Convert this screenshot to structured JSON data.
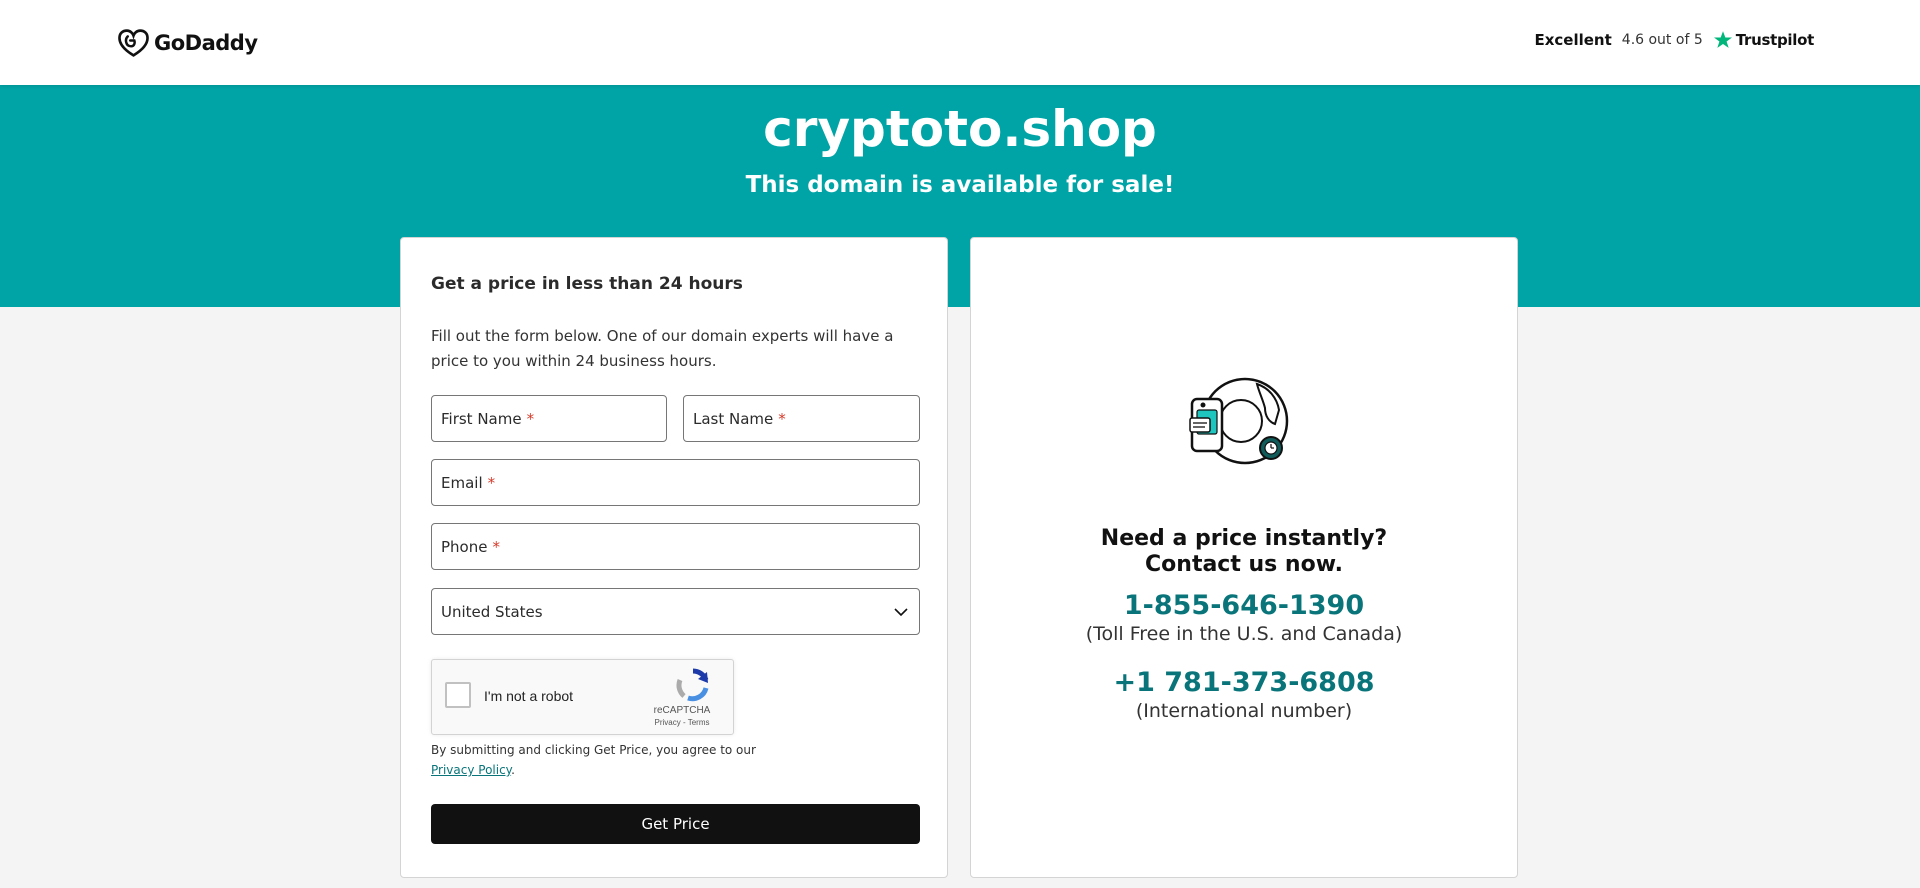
{
  "header": {
    "logo_text": "GoDaddy",
    "rating_label": "Excellent",
    "rating_score": "4.6 out of 5",
    "trustpilot_text": "Trustpilot"
  },
  "hero": {
    "domain": "cryptoto.shop",
    "subtitle": "This domain is available for sale!"
  },
  "form": {
    "title": "Get a price in less than 24 hours",
    "description": "Fill out the form below. One of our domain experts will have a price to you within 24 business hours.",
    "first_name_label": "First Name",
    "last_name_label": "Last Name",
    "email_label": "Email",
    "phone_label": "Phone",
    "required_marker": "*",
    "country_value": "United States",
    "captcha": {
      "label": "I'm not a robot",
      "brand": "reCAPTCHA",
      "links": "Privacy - Terms"
    },
    "legal_text": "By submitting and clicking Get Price, you agree to our",
    "privacy_link": "Privacy Policy",
    "legal_end": ".",
    "submit_label": "Get Price"
  },
  "contact": {
    "heading_line1": "Need a price instantly?",
    "heading_line2": "Contact us now.",
    "phone_tollfree": "1-855-646-1390",
    "phone_tollfree_note": "(Toll Free in the U.S. and Canada)",
    "phone_intl": "+1 781-373-6808",
    "phone_intl_note": "(International number)"
  },
  "colors": {
    "brand_teal": "#00a4a6",
    "link_teal": "#09757a",
    "button_black": "#111111",
    "trustpilot_green": "#00b67a"
  }
}
